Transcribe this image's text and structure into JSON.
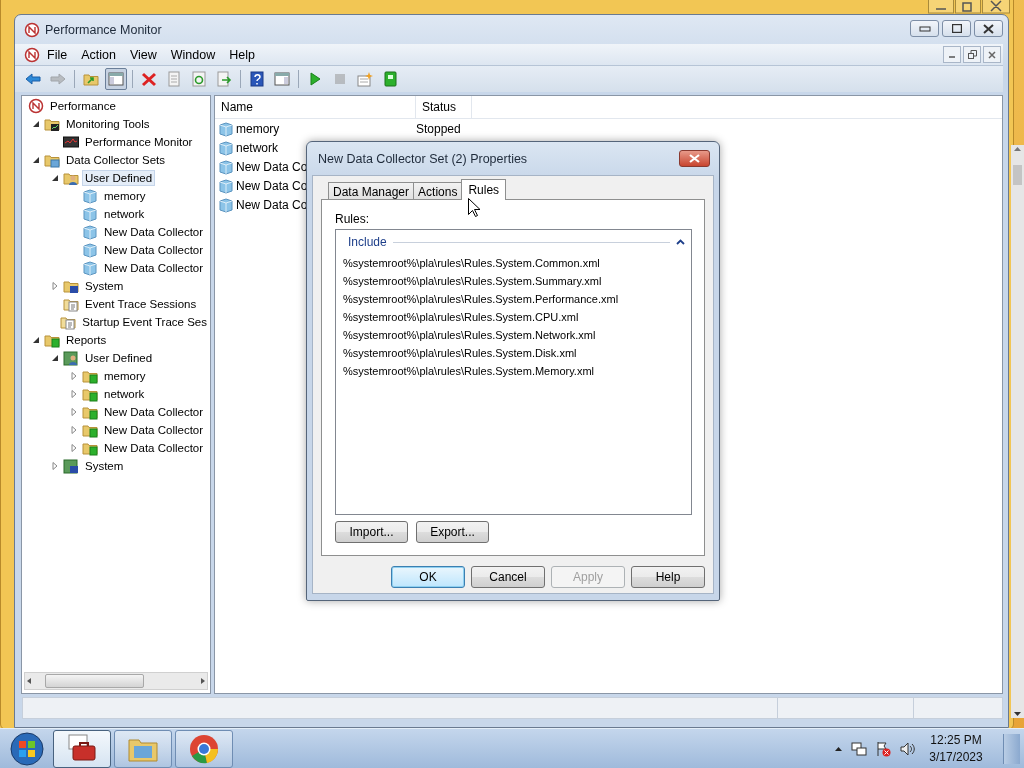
{
  "window": {
    "title": "Performance Monitor"
  },
  "menu": [
    "File",
    "Action",
    "View",
    "Window",
    "Help"
  ],
  "toolbar": [
    {
      "buttons": [
        {
          "kind": "back",
          "pressed": false,
          "disabled": false
        },
        {
          "kind": "forward",
          "pressed": false,
          "disabled": true
        }
      ]
    },
    {
      "buttons": [
        {
          "kind": "up",
          "pressed": false,
          "disabled": false
        },
        {
          "kind": "tree",
          "pressed": true,
          "disabled": false
        }
      ]
    },
    {
      "buttons": [
        {
          "kind": "delete",
          "pressed": false,
          "disabled": false
        },
        {
          "kind": "properties",
          "pressed": false,
          "disabled": false
        },
        {
          "kind": "refresh",
          "pressed": false,
          "disabled": false
        },
        {
          "kind": "export",
          "pressed": false,
          "disabled": false
        }
      ]
    },
    {
      "buttons": [
        {
          "kind": "help",
          "pressed": false,
          "disabled": false
        },
        {
          "kind": "pane",
          "pressed": false,
          "disabled": false
        }
      ]
    },
    {
      "buttons": [
        {
          "kind": "start",
          "pressed": false,
          "disabled": false
        },
        {
          "kind": "stop",
          "pressed": false,
          "disabled": true
        },
        {
          "kind": "new",
          "pressed": false,
          "disabled": false
        },
        {
          "kind": "report",
          "pressed": false,
          "disabled": false
        }
      ]
    }
  ],
  "tree": [
    {
      "label": "Performance",
      "kind": "performance",
      "expandable": false,
      "selected": false,
      "children": [
        {
          "label": "Monitoring Tools",
          "kind": "tools",
          "expandable": true,
          "expanded": true,
          "selected": false,
          "children": [
            {
              "label": "Performance Monitor",
              "kind": "monitor",
              "expandable": false,
              "selected": false
            }
          ]
        },
        {
          "label": "Data Collector Sets",
          "kind": "collector",
          "expandable": true,
          "expanded": true,
          "selected": false,
          "children": [
            {
              "label": "User Defined",
              "kind": "user",
              "expandable": true,
              "expanded": true,
              "selected": true,
              "children": [
                {
                  "label": "memory",
                  "kind": "cube",
                  "expandable": false,
                  "selected": false
                },
                {
                  "label": "network",
                  "kind": "cube",
                  "expandable": false,
                  "selected": false
                },
                {
                  "label": "New Data Collector",
                  "kind": "cube",
                  "expandable": false,
                  "selected": false
                },
                {
                  "label": "New Data Collector",
                  "kind": "cube",
                  "expandable": false,
                  "selected": false
                },
                {
                  "label": "New Data Collector",
                  "kind": "cube",
                  "expandable": false,
                  "selected": false
                }
              ]
            },
            {
              "label": "System",
              "kind": "system",
              "expandable": true,
              "expanded": false,
              "selected": false
            },
            {
              "label": "Event Trace Sessions",
              "kind": "trace",
              "expandable": false,
              "selected": false
            },
            {
              "label": "Startup Event Trace Ses",
              "kind": "trace",
              "expandable": false,
              "selected": false
            }
          ]
        },
        {
          "label": "Reports",
          "kind": "reports",
          "expandable": true,
          "expanded": true,
          "selected": false,
          "children": [
            {
              "label": "User Defined",
              "kind": "reportuser",
              "expandable": true,
              "expanded": true,
              "selected": false,
              "children": [
                {
                  "label": "memory",
                  "kind": "reportitem",
                  "expandable": true,
                  "expanded": false,
                  "selected": false
                },
                {
                  "label": "network",
                  "kind": "reportitem",
                  "expandable": true,
                  "expanded": false,
                  "selected": false
                },
                {
                  "label": "New Data Collector",
                  "kind": "reportitem",
                  "expandable": true,
                  "expanded": false,
                  "selected": false
                },
                {
                  "label": "New Data Collector",
                  "kind": "reportitem",
                  "expandable": true,
                  "expanded": false,
                  "selected": false
                },
                {
                  "label": "New Data Collector",
                  "kind": "reportitem",
                  "expandable": true,
                  "expanded": false,
                  "selected": false
                }
              ]
            },
            {
              "label": "System",
              "kind": "reportsystem",
              "expandable": true,
              "expanded": false,
              "selected": false
            }
          ]
        }
      ]
    }
  ],
  "list": {
    "columns": [
      "Name",
      "Status"
    ],
    "rows": [
      {
        "name": "memory",
        "status": "Stopped"
      },
      {
        "name": "network"
      },
      {
        "name": "New Data Co"
      },
      {
        "name": "New Data Co"
      },
      {
        "name": "New Data Co"
      }
    ]
  },
  "dialog": {
    "title": "New Data Collector Set (2) Properties",
    "tabs": [
      {
        "label": "Data Manager",
        "selected": false
      },
      {
        "label": "Actions",
        "selected": false
      },
      {
        "label": "Rules",
        "selected": true
      }
    ],
    "rules_label": "Rules:",
    "group": {
      "title": "Include",
      "expanded": true,
      "items": [
        "%systemroot%\\pla\\rules\\Rules.System.Common.xml",
        "%systemroot%\\pla\\rules\\Rules.System.Summary.xml",
        "%systemroot%\\pla\\rules\\Rules.System.Performance.xml",
        "%systemroot%\\pla\\rules\\Rules.System.CPU.xml",
        "%systemroot%\\pla\\rules\\Rules.System.Network.xml",
        "%systemroot%\\pla\\rules\\Rules.System.Disk.xml",
        "%systemroot%\\pla\\rules\\Rules.System.Memory.xml"
      ]
    },
    "side_buttons": [
      "Import...",
      "Export..."
    ],
    "buttons": [
      {
        "label": "OK",
        "default": true,
        "disabled": false
      },
      {
        "label": "Cancel",
        "default": false,
        "disabled": false
      },
      {
        "label": "Apply",
        "default": false,
        "disabled": true
      },
      {
        "label": "Help",
        "default": false,
        "disabled": false
      }
    ]
  },
  "taskbar": {
    "apps": [
      {
        "kind": "toolbox",
        "active": true
      },
      {
        "kind": "folder",
        "active": false
      },
      {
        "kind": "browser",
        "active": false
      }
    ],
    "clock": {
      "time": "12:25 PM",
      "date": "3/17/2023"
    }
  }
}
